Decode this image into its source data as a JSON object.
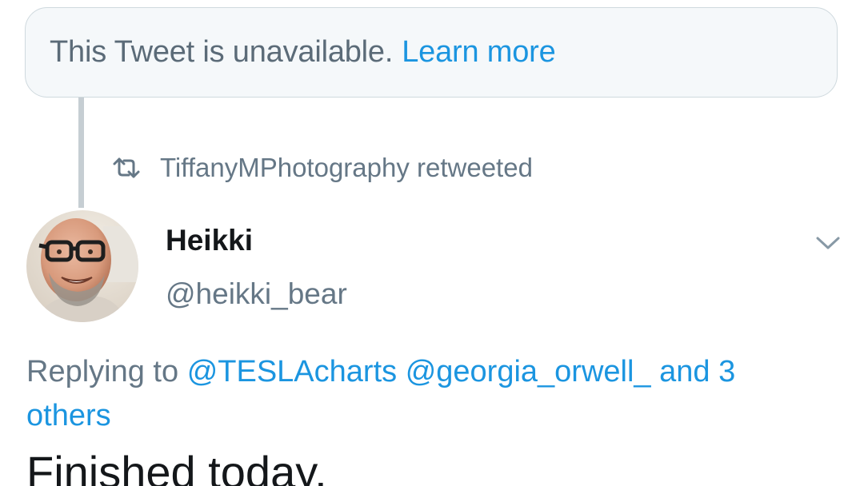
{
  "unavailable": {
    "text": "This Tweet is unavailable.",
    "link": "Learn more"
  },
  "retweet": {
    "icon": "retweet-icon",
    "text": "TiffanyMPhotography retweeted"
  },
  "author": {
    "display_name": "Heikki",
    "handle": "@heikki_bear"
  },
  "reply": {
    "prefix": "Replying to",
    "mention_1": "@TESLAcharts",
    "mention_2": "@georgia_orwell_",
    "and": "and",
    "others_count": "3",
    "others_word": "others"
  },
  "tweet": {
    "text": "Finished today."
  },
  "colors": {
    "link": "#1b95e0",
    "muted": "#657786",
    "text": "#14171a",
    "box_bg": "#f5f8fa"
  }
}
